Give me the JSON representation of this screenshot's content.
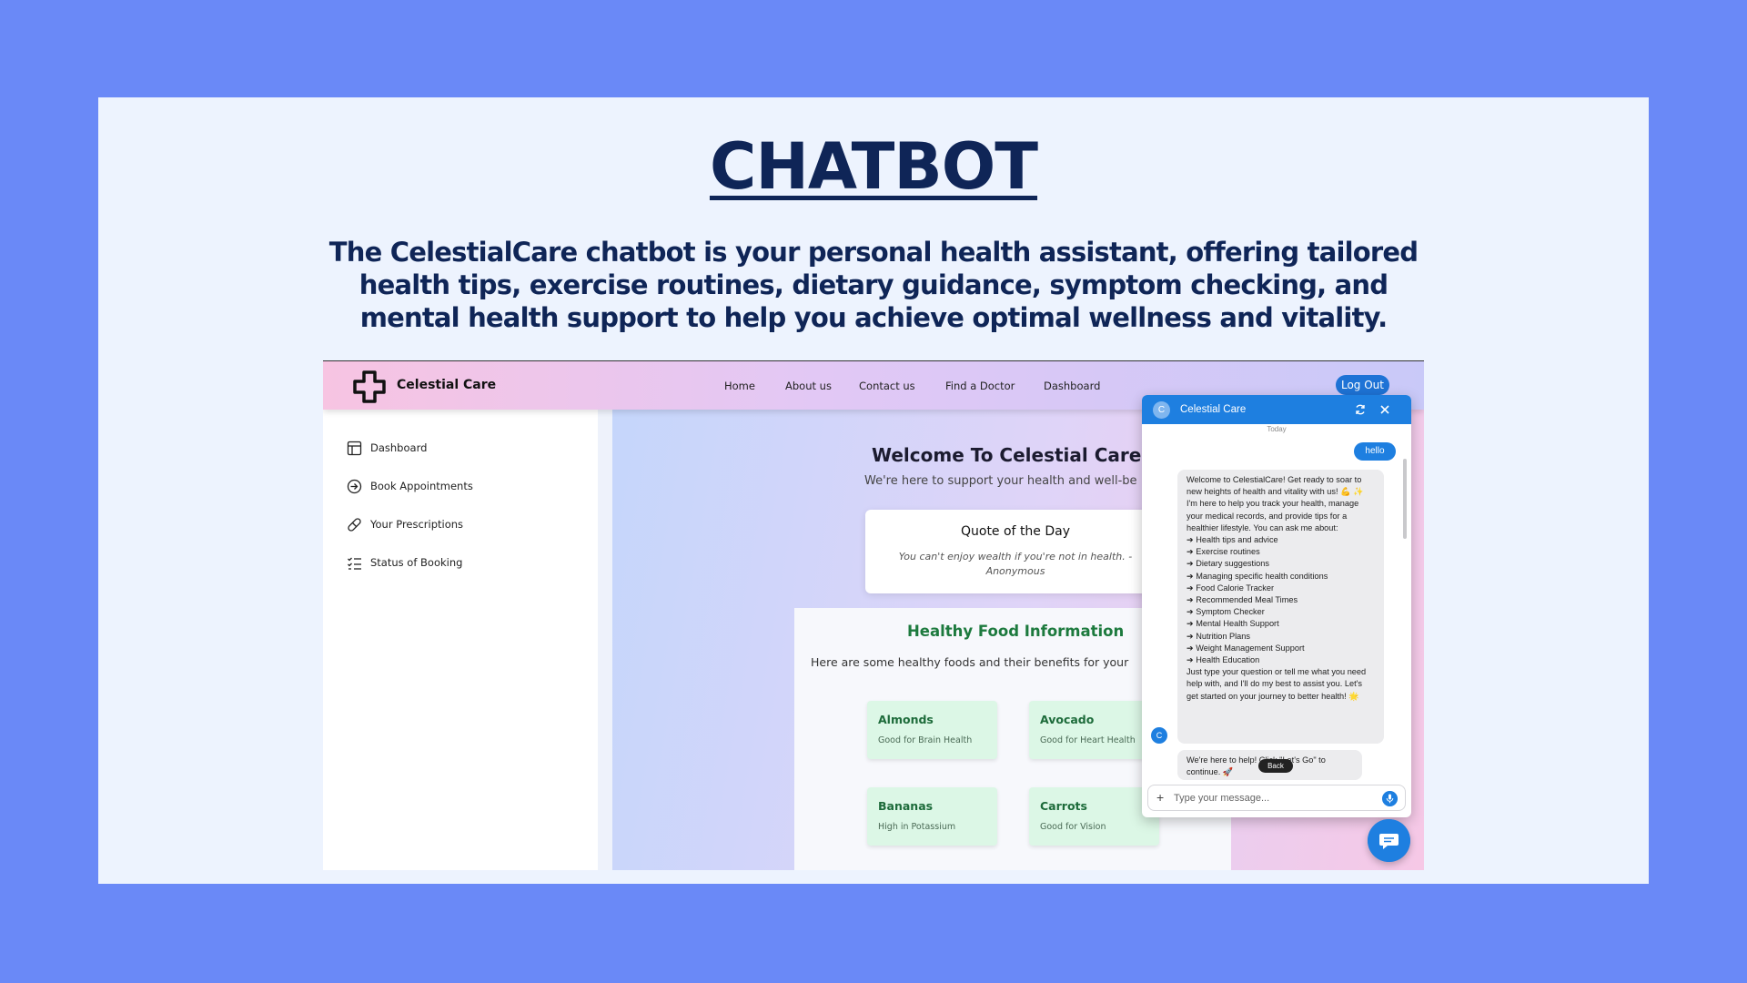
{
  "slide": {
    "title": "CHATBOT",
    "description": "The CelestialCare chatbot is your personal health assistant, offering tailored health tips, exercise routines, dietary guidance, symptom checking, and mental health support to help you achieve optimal wellness and vitality."
  },
  "nav": {
    "brand": "Celestial Care",
    "links": [
      "Home",
      "About us",
      "Contact us",
      "Find a Doctor",
      "Dashboard"
    ],
    "logout": "Log Out"
  },
  "sidebar": {
    "items": [
      {
        "label": "Dashboard",
        "icon": "layout-icon"
      },
      {
        "label": "Book Appointments",
        "icon": "arrow-circle-icon"
      },
      {
        "label": "Your Prescriptions",
        "icon": "pill-icon"
      },
      {
        "label": "Status of Booking",
        "icon": "checklist-icon"
      }
    ]
  },
  "main": {
    "welcome_title": "Welcome To Celestial Care",
    "welcome_sub": "We're here to support your health and well-be",
    "quote": {
      "title": "Quote of the Day",
      "text": "You can't enjoy wealth if you're not in health. - Anonymous"
    },
    "food": {
      "title": "Healthy Food Information",
      "subtitle": "Here are some healthy foods and their benefits for your",
      "items": [
        {
          "name": "Almonds",
          "benefit": "Good for Brain Health"
        },
        {
          "name": "Avocado",
          "benefit": "Good for Heart Health"
        },
        {
          "name": "Bananas",
          "benefit": "High in Potassium"
        },
        {
          "name": "Carrots",
          "benefit": "Good for Vision"
        }
      ]
    }
  },
  "chat": {
    "avatar_letter": "C",
    "title": "Celestial Care",
    "date_label": "Today",
    "user_message": "hello",
    "bot_message_lines": [
      "Welcome to CelestialCare! Get ready to soar to new heights of health and vitality with us! 💪 ✨",
      "I'm here to help you track your health, manage your medical records, and provide tips for a healthier lifestyle. You can ask me about:",
      "➔ Health tips and advice",
      "➔ Exercise routines",
      "➔ Dietary suggestions",
      "➔ Managing specific health conditions",
      "➔ Food Calorie Tracker",
      "➔ Recommended Meal Times",
      "➔ Symptom Checker",
      "➔ Mental Health Support",
      "➔ Nutrition Plans",
      "➔ Weight Management Support",
      "➔ Health Education",
      "Just type your question or tell me what you need help with, and I'll do my best to assist you. Let's get started on your journey to better health! 🌟"
    ],
    "bot_message_2": "We're here to help! Click \"Let's Go\" to continue. 🚀",
    "tooltip": "Back",
    "input_placeholder": "Type your message...",
    "accent": "#1e7fe0"
  },
  "colors": {
    "page_bg": "#6a89f7",
    "title_color": "#0f2557",
    "food_green": "#1d7a3e"
  }
}
